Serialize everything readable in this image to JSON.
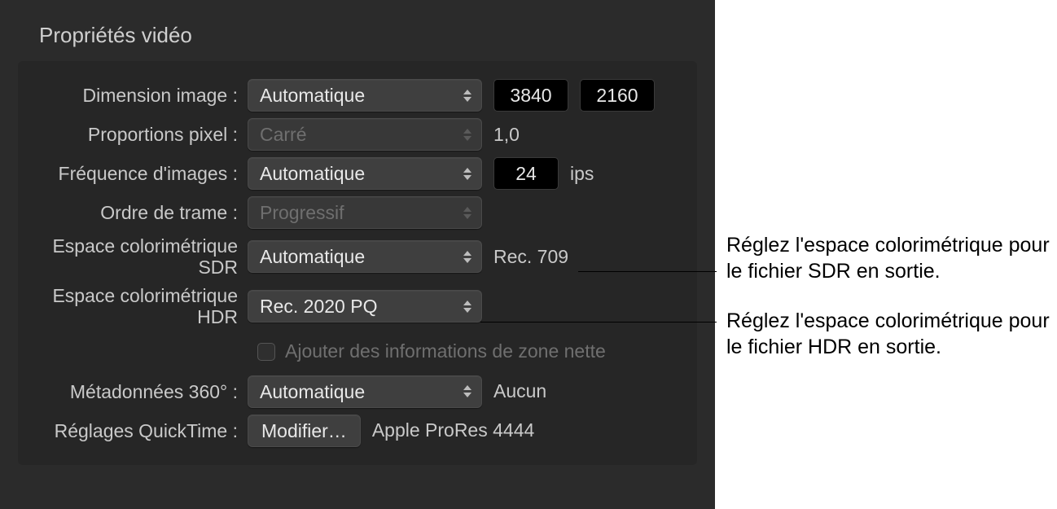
{
  "section_title": "Propriétés vidéo",
  "rows": {
    "dimension": {
      "label": "Dimension image :",
      "select": "Automatique",
      "width": "3840",
      "height": "2160"
    },
    "pixel_aspect": {
      "label": "Proportions pixel :",
      "select": "Carré",
      "value": "1,0"
    },
    "framerate": {
      "label": "Fréquence d'images :",
      "select": "Automatique",
      "value": "24",
      "unit": "ips"
    },
    "field_order": {
      "label": "Ordre de trame :",
      "select": "Progressif"
    },
    "sdr_colorspace": {
      "label": "Espace colorimétrique SDR",
      "select": "Automatique",
      "value": "Rec. 709"
    },
    "hdr_colorspace": {
      "label": "Espace colorimétrique HDR",
      "select": "Rec. 2020 PQ"
    },
    "clean_aperture": {
      "label": "Ajouter des informations de zone nette"
    },
    "metadata_360": {
      "label": "Métadonnées 360° :",
      "select": "Automatique",
      "value": "Aucun"
    },
    "quicktime": {
      "label": "Réglages QuickTime :",
      "button": "Modifier…",
      "value": "Apple ProRes 4444"
    }
  },
  "annotations": {
    "sdr": "Réglez l'espace colorimétrique pour le fichier SDR en sortie.",
    "hdr": "Réglez l'espace colorimétrique pour le fichier HDR en sortie."
  }
}
